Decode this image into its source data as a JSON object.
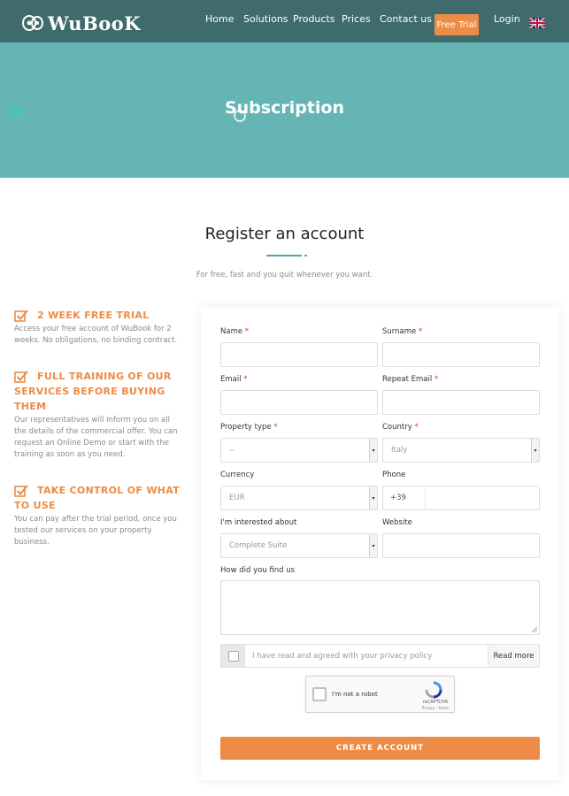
{
  "header": {
    "logo_text": "WuBooK",
    "nav": [
      "Home",
      "Solutions",
      "Products",
      "Prices",
      "Contact us"
    ],
    "free_trial_label": "Free Trial",
    "login_label": "Login",
    "language_flag": "uk-flag-icon"
  },
  "hero": {
    "title": "Subscription"
  },
  "register": {
    "title": "Register an account",
    "subtitle": "For free, fast and you quit whenever you want."
  },
  "features": [
    {
      "title": "2 WEEK FREE TRIAL",
      "text": "Access your free account of WuBook for 2 weeks. No obligations, no binding contract."
    },
    {
      "title": "FULL TRAINING OF OUR SERVICES BEFORE BUYING THEM",
      "text": "Our representatives will inform you on all the details of the commercial offer. You can request an Online Demo or start with the training as soon as you need."
    },
    {
      "title": "TAKE CONTROL OF WHAT TO USE",
      "text": "You can pay after the trial period, once you tested our services on your property business."
    }
  ],
  "form": {
    "name_label": "Name",
    "surname_label": "Surname",
    "email_label": "Email",
    "repeat_email_label": "Repeat Email",
    "property_type_label": "Property type",
    "property_type_value": "--",
    "country_label": "Country",
    "country_value": "Italy",
    "currency_label": "Currency",
    "currency_value": "EUR",
    "phone_label": "Phone",
    "phone_prefix": "+39",
    "interested_label": "I'm interested about",
    "interested_value": "Complete Suite",
    "website_label": "Website",
    "how_found_label": "How did you find us",
    "required_mark": "*",
    "privacy_text": "I have read and agreed with your privacy policy",
    "read_more_label": "Read more",
    "captcha_label": "I'm not a robot",
    "captcha_brand": "reCAPTCHA",
    "captcha_links": "Privacy - Terms",
    "submit_label": "CREATE ACCOUNT"
  },
  "colors": {
    "topbar": "#3f6b6c",
    "hero": "#65b5b4",
    "accent": "#ec8c46",
    "divider": "#4aa8ae"
  }
}
